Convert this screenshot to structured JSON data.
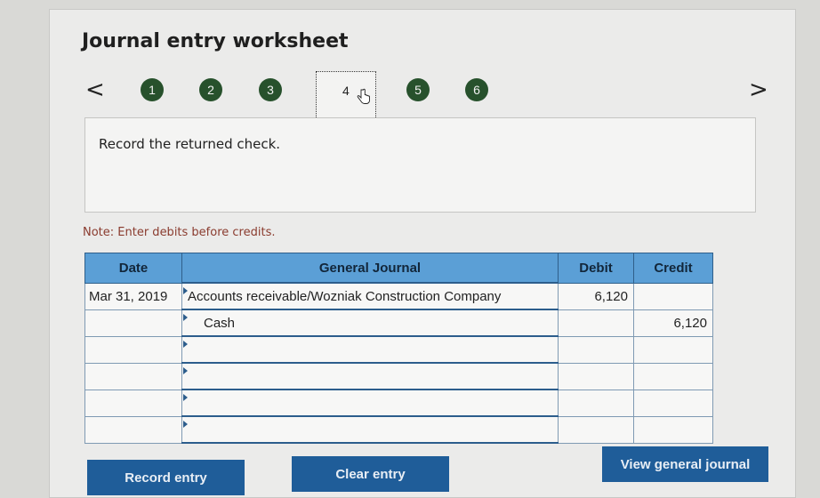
{
  "worksheet": {
    "title": "Journal entry worksheet",
    "nav": {
      "prev_glyph": "<",
      "next_glyph": ">",
      "steps": [
        "1",
        "2",
        "3",
        "4",
        "5",
        "6"
      ],
      "current_step": "4"
    },
    "prompt": "Record the returned check.",
    "note": "Note: Enter debits before credits."
  },
  "journal": {
    "headers": {
      "date": "Date",
      "account": "General Journal",
      "debit": "Debit",
      "credit": "Credit"
    },
    "rows": [
      {
        "date": "Mar 31, 2019",
        "account": "Accounts receivable/Wozniak Construction Company",
        "debit": "6,120",
        "credit": ""
      },
      {
        "date": "",
        "account": "Cash",
        "debit": "",
        "credit": "6,120"
      },
      {
        "date": "",
        "account": "",
        "debit": "",
        "credit": ""
      },
      {
        "date": "",
        "account": "",
        "debit": "",
        "credit": ""
      },
      {
        "date": "",
        "account": "",
        "debit": "",
        "credit": ""
      },
      {
        "date": "",
        "account": "",
        "debit": "",
        "credit": ""
      }
    ]
  },
  "buttons": {
    "record": "Record entry",
    "clear": "Clear entry",
    "view": "View general journal"
  },
  "colors": {
    "step_circle": "#27512c",
    "header_blue": "#5b9fd6",
    "button_blue": "#1f5d99",
    "note_red": "#8a3b2e"
  },
  "icons": {
    "cursor": "hand-pointer-icon"
  }
}
